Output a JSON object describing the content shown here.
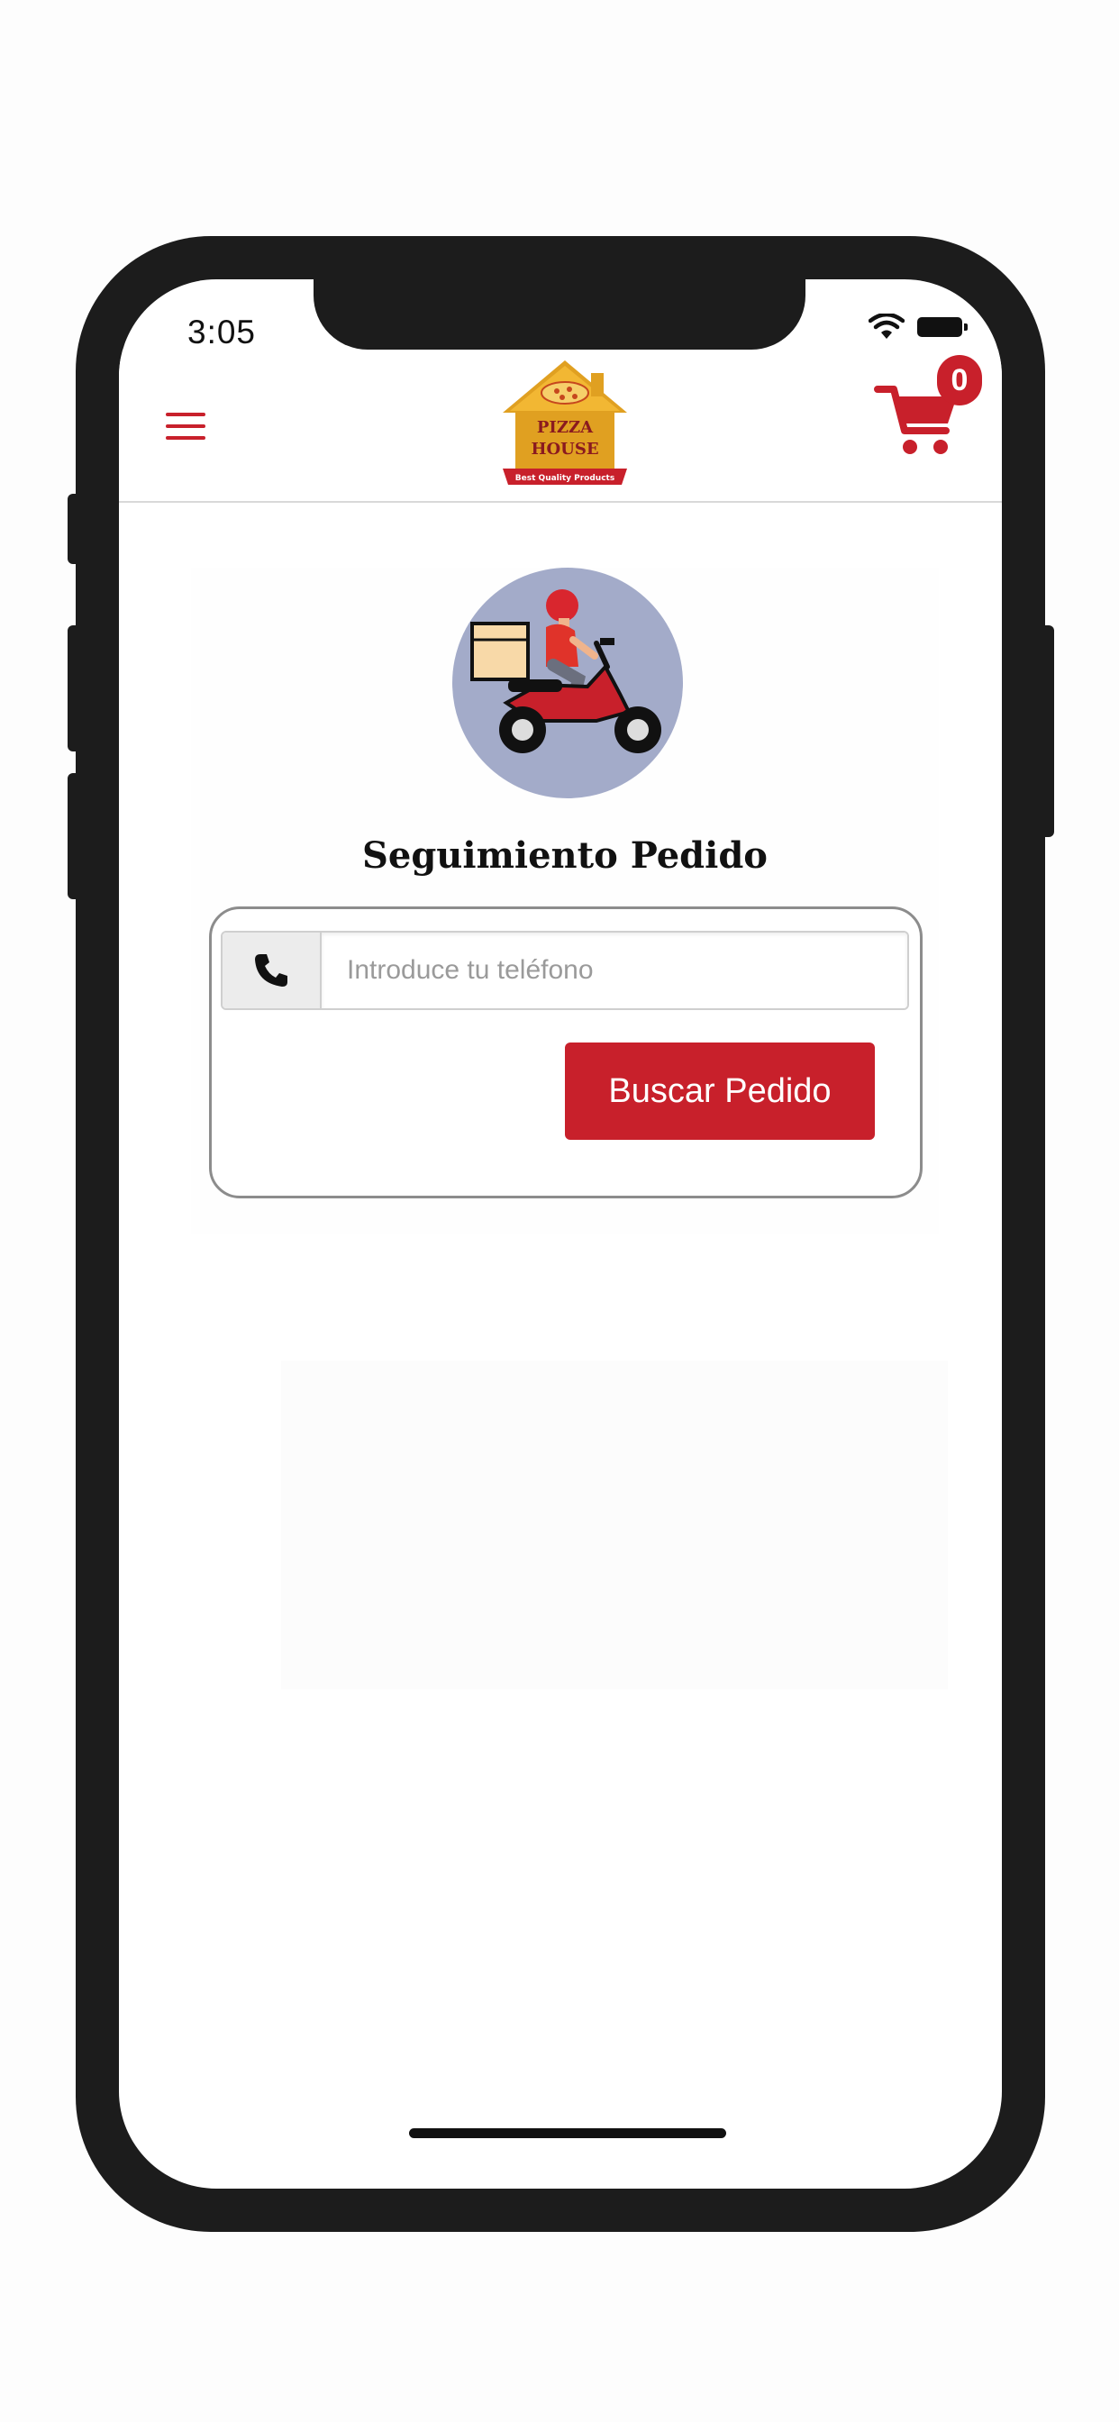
{
  "status_bar": {
    "time": "3:05",
    "icons": [
      "wifi-icon",
      "battery-icon"
    ]
  },
  "header": {
    "menu_icon": "hamburger-menu-icon",
    "logo": {
      "line1": "PIZZA",
      "line2": "HOUSE",
      "tagline": "Best Quality Products"
    },
    "cart": {
      "icon": "shopping-cart-icon",
      "count": "0"
    }
  },
  "main": {
    "illustration": "delivery-scooter-icon",
    "title": "Seguimiento Pedido",
    "phone_field": {
      "icon": "phone-icon",
      "placeholder": "Introduce tu teléfono",
      "value": ""
    },
    "search_button_label": "Buscar Pedido"
  },
  "colors": {
    "brand_red": "#c8202b",
    "frame": "#1c1c1c",
    "illustration_bg": "#a3abc9"
  }
}
